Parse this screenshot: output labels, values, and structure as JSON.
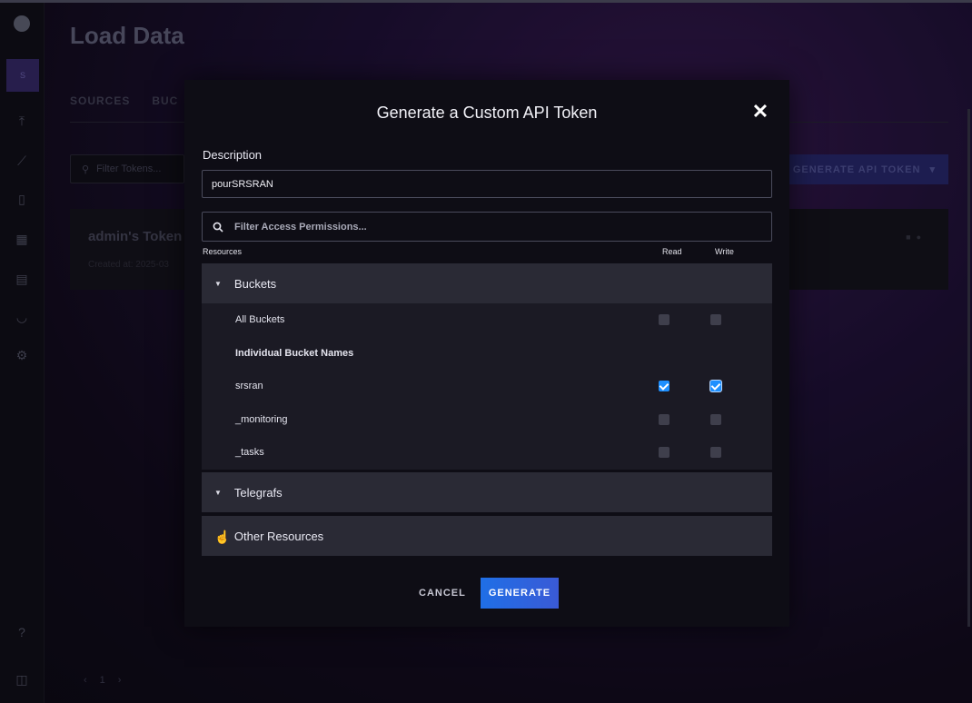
{
  "background": {
    "page_title": "Load Data",
    "tabs": [
      "SOURCES",
      "BUC"
    ],
    "filter_tokens_placeholder": "Filter Tokens...",
    "generate_button_label": "GENERATE API TOKEN",
    "token_card": {
      "name": "admin's Token",
      "created": "Created at: 2025-03"
    },
    "avatar_letter": "S",
    "pager_current": "1"
  },
  "modal": {
    "title": "Generate a Custom API Token",
    "description_label": "Description",
    "description_value": "pourSRSRAN",
    "filter_placeholder": "Filter Access Permissions...",
    "columns": {
      "resources": "Resources",
      "read": "Read",
      "write": "Write"
    },
    "sections": {
      "buckets": "Buckets",
      "telegrafs": "Telegrafs",
      "other": "Other Resources"
    },
    "bucket_rows": {
      "all": {
        "label": "All Buckets",
        "read": false,
        "write": false
      },
      "individual_header": "Individual Bucket Names",
      "srsran": {
        "label": "srsran",
        "read": true,
        "write": true
      },
      "monitoring": {
        "label": "_monitoring",
        "read": false,
        "write": false
      },
      "tasks": {
        "label": "_tasks",
        "read": false,
        "write": false
      }
    },
    "cancel_label": "CANCEL",
    "generate_label": "GENERATE"
  },
  "colors": {
    "accent": "#1e90ff",
    "generate_gradient_start": "#1f6fe6",
    "section_header": "#2a2a35"
  }
}
